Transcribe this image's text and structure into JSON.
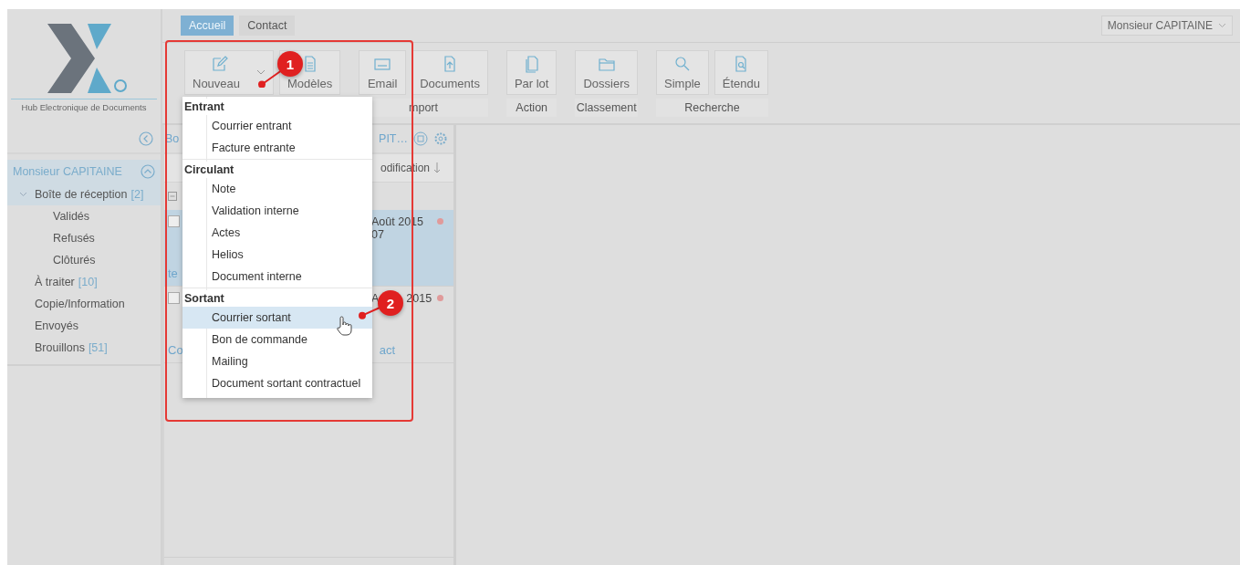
{
  "logo": {
    "caption": "Hub Electronique de Documents"
  },
  "tabs": [
    {
      "label": "Accueil",
      "selected": true
    },
    {
      "label": "Contact",
      "selected": false
    }
  ],
  "user_menu": {
    "label": "Monsieur CAPITAINE"
  },
  "ribbon": {
    "groups": [
      {
        "buttons": [
          {
            "label": "Nouveau",
            "has_caret": true
          },
          {
            "label": "Modèles",
            "has_caret": false
          }
        ]
      },
      {
        "label": "mport",
        "buttons": [
          {
            "label": "Email",
            "has_caret": false
          },
          {
            "label": "Documents",
            "has_caret": false
          }
        ]
      },
      {
        "label": "Action",
        "buttons": [
          {
            "label": "Par lot",
            "has_caret": false
          }
        ]
      },
      {
        "label": "Classement",
        "buttons": [
          {
            "label": "Dossiers",
            "has_caret": false
          }
        ]
      },
      {
        "label": "Recherche",
        "buttons": [
          {
            "label": "Simple",
            "has_caret": false
          },
          {
            "label": "Étendu",
            "has_caret": false
          }
        ]
      }
    ]
  },
  "sidebar": {
    "title": "Monsieur CAPITAINE",
    "expanded": true,
    "items": [
      {
        "label": "Boîte de réception",
        "count": "[2]",
        "selected": true,
        "expanded": true,
        "children": [
          {
            "label": "Validés",
            "selected": false
          },
          {
            "label": "Refusés",
            "selected": false
          },
          {
            "label": "Clôturés",
            "selected": false
          }
        ]
      },
      {
        "label": "À traiter",
        "count": "[10]",
        "selected": false
      },
      {
        "label": "Copie/Information",
        "selected": false
      },
      {
        "label": "Envoyés",
        "selected": false
      },
      {
        "label": "Brouillons",
        "count": "[51]",
        "selected": false
      }
    ]
  },
  "list_panel": {
    "title_start": "Bo",
    "title_end": "PIT…",
    "column": "odification",
    "rows": [
      {
        "selected": true,
        "checked": false,
        "date_start": "Août 2015",
        "date_time": "07",
        "link_start": "te"
      },
      {
        "selected": false,
        "checked": false,
        "date_start": "A",
        "date_end": "2015",
        "link_start": "Co",
        "link_end": "act"
      }
    ]
  },
  "menu": {
    "sections": [
      {
        "title": "Entrant",
        "items": [
          {
            "label": "Courrier entrant",
            "selected": false
          },
          {
            "label": "Facture entrante",
            "selected": false
          }
        ]
      },
      {
        "title": "Circulant",
        "items": [
          {
            "label": "Note",
            "selected": false
          },
          {
            "label": "Validation interne",
            "selected": false
          },
          {
            "label": "Actes",
            "selected": false
          },
          {
            "label": "Helios",
            "selected": false
          },
          {
            "label": "Document interne",
            "selected": false
          }
        ]
      },
      {
        "title": "Sortant",
        "items": [
          {
            "label": "Courrier sortant",
            "selected": true
          },
          {
            "label": "Bon de commande",
            "selected": false
          },
          {
            "label": "Mailing",
            "selected": false
          },
          {
            "label": "Document sortant contractuel",
            "selected": false
          }
        ]
      }
    ]
  },
  "callouts": [
    {
      "number": "1"
    },
    {
      "number": "2"
    }
  ]
}
